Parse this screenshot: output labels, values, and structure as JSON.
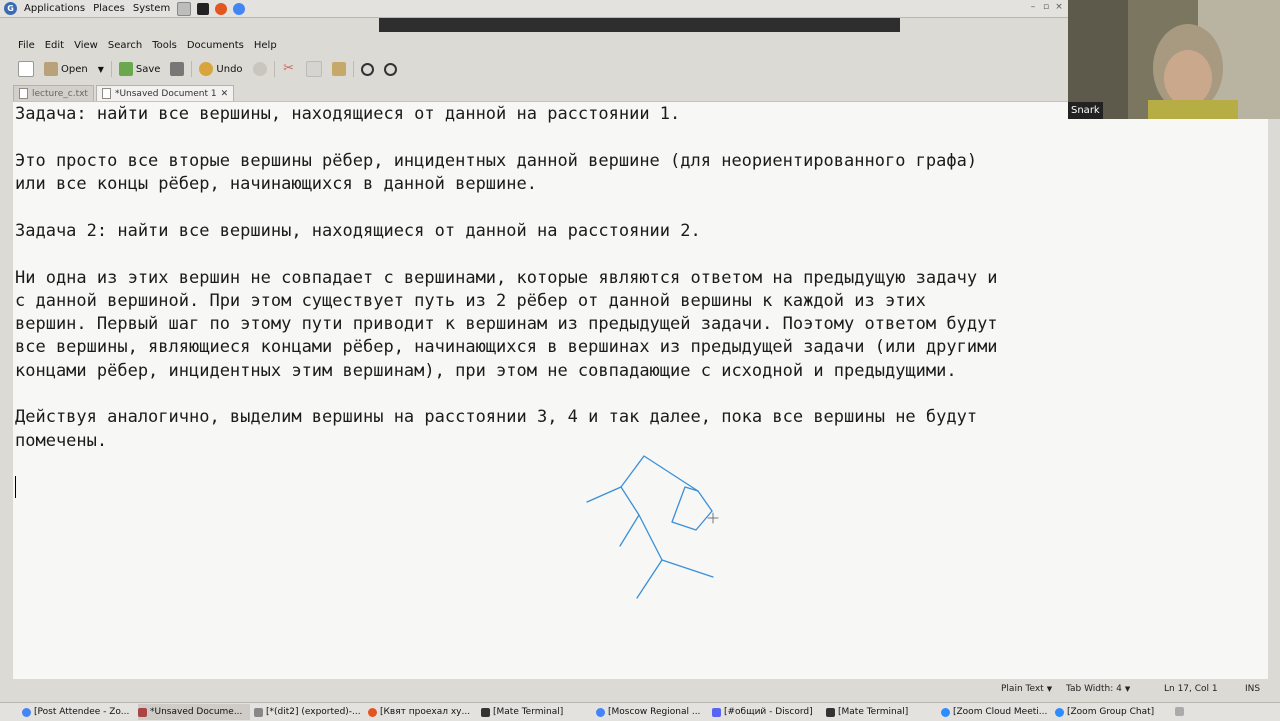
{
  "panel": {
    "menus": [
      "Applications",
      "Places",
      "System"
    ]
  },
  "menubar": {
    "items": [
      "File",
      "Edit",
      "View",
      "Search",
      "Tools",
      "Documents",
      "Help"
    ]
  },
  "toolbar": {
    "open_label": "Open",
    "save_label": "Save",
    "undo_label": "Undo"
  },
  "tabs": [
    {
      "label": "lecture_c.txt"
    },
    {
      "label": "*Unsaved Document 1"
    }
  ],
  "editor": {
    "lines": [
      "Задача: найти все вершины, находящиеся от данной на расстоянии 1.",
      "Это просто все вторые вершины рёбер, инцидентных данной вершине (для неориентированного графа)",
      "или все концы рёбер, начинающихся в данной вершине.",
      "Задача 2: найти все вершины, находящиеся от данной на расстоянии 2.",
      "Ни одна из этих вершин не совпадает с вершинами, которые являются ответом на предыдущую задачу и",
      "с данной вершиной. При этом существует путь из 2 рёбер от данной вершины к каждой из этих",
      "вершин. Первый шаг по этому пути приводит к вершинам из предыдущей задачи. Поэтому ответом будут",
      "все вершины, являющиеся концами рёбер, начинающихся в вершинах из предыдущей задачи (или другими",
      "концами рёбер, инцидентных этим вершинам), при этом не совпадающие с исходной и предыдущими.",
      "Действуя аналогично, выделим вершины на расстоянии 3, 4 и так далее, пока все вершины не будут",
      "помечены."
    ]
  },
  "webcam": {
    "name": "Snark"
  },
  "statusbar": {
    "syntax": "Plain Text",
    "tab_width": "Tab Width: 4",
    "position": "Ln 17, Col 1",
    "mode": "INS"
  },
  "taskbar": [
    {
      "label": "[Post Attendee - Zo..."
    },
    {
      "label": "*Unsaved Docume..."
    },
    {
      "label": "[*(dit2] (exported)-..."
    },
    {
      "label": "[Квят проехал ху..."
    },
    {
      "label": "[Mate Terminal]"
    },
    {
      "label": "[Moscow Regional ..."
    },
    {
      "label": "[#общий - Discord]"
    },
    {
      "label": "[Mate Terminal]"
    },
    {
      "label": "[Zoom Cloud Meeti..."
    },
    {
      "label": "[Zoom Group Chat]"
    }
  ],
  "colors": {
    "drawing_stroke": "#3a8fd6",
    "editor_bg": "#f7f7f6",
    "panel_bg": "#e4e2de"
  }
}
